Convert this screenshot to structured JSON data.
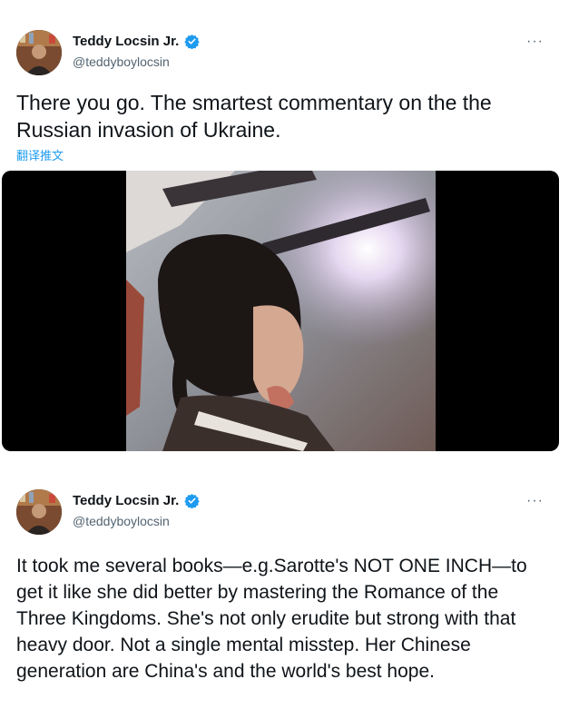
{
  "tweets": [
    {
      "author": {
        "name": "Teddy Locsin Jr.",
        "handle": "@teddyboylocsin",
        "verified": true
      },
      "more_label": "···",
      "text": "There you go. The smartest commentary on the the Russian invasion of Ukraine.",
      "translate_label": "翻译推文",
      "has_video": true
    },
    {
      "author": {
        "name": "Teddy Locsin Jr.",
        "handle": "@teddyboylocsin",
        "verified": true
      },
      "more_label": "···",
      "text": "It took me several books—e.g.Sarotte's NOT ONE INCH—to get it like she did better by mastering the Romance of the Three Kingdoms. She's not only erudite but strong with that heavy door. Not a single mental misstep. Her Chinese generation are China's and the world's best hope."
    }
  ],
  "colors": {
    "verified": "#1d9bf0",
    "link": "#1d9bf0",
    "secondary_text": "#536471"
  }
}
